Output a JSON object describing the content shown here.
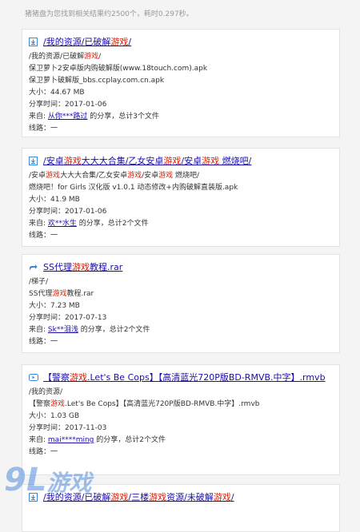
{
  "summary": "猪猪盘为您找到相关结果约2500个，耗时0.297秒。",
  "results": [
    {
      "icon": "download-icon",
      "title": [
        {
          "t": "/我的资源/已破解"
        },
        {
          "t": "游戏",
          "hl": true
        },
        {
          "t": "/"
        }
      ],
      "lines": [
        [
          {
            "t": "/我的资源/已破解"
          },
          {
            "t": "游戏",
            "hl": true
          },
          {
            "t": "/"
          }
        ],
        [
          {
            "t": "保卫萝卜2安卓版内购破解版(www.18touch.com).apk"
          }
        ],
        [
          {
            "t": "保卫萝卜破解版_bbs.ccplay.com.cn.apk"
          }
        ],
        [
          {
            "t": "大小：44.67 MB"
          }
        ],
        [
          {
            "t": "分享时间：2017-01-06"
          }
        ],
        [
          {
            "t": "来自: "
          },
          {
            "t": "从你***路过",
            "link": true
          },
          {
            "t": " 的分享，总计3个文件"
          }
        ],
        [
          {
            "t": "线路：一"
          }
        ]
      ]
    },
    {
      "icon": "download-icon",
      "title": [
        {
          "t": "/安卓"
        },
        {
          "t": "游戏",
          "hl": true
        },
        {
          "t": "大大大合集/乙女安卓"
        },
        {
          "t": "游戏",
          "hl": true
        },
        {
          "t": "/安卓"
        },
        {
          "t": "游戏",
          "hl": true
        },
        {
          "t": " 燃烧吧/"
        }
      ],
      "lines": [
        [
          {
            "t": "/安卓"
          },
          {
            "t": "游戏",
            "hl": true
          },
          {
            "t": "大大大合集/乙女安卓"
          },
          {
            "t": "游戏",
            "hl": true
          },
          {
            "t": "/安卓"
          },
          {
            "t": "游戏",
            "hl": true
          },
          {
            "t": " 燃烧吧/"
          }
        ],
        [
          {
            "t": "燃烧吧！for Girls 汉化版 v1.0.1 动态修改+内购破解直装版.apk"
          }
        ],
        [
          {
            "t": "大小：41.9 MB"
          }
        ],
        [
          {
            "t": "分享时间：2017-01-06"
          }
        ],
        [
          {
            "t": "来自: "
          },
          {
            "t": "欢**水生",
            "link": true
          },
          {
            "t": " 的分享，总计2个文件"
          }
        ],
        [
          {
            "t": "线路：一"
          }
        ]
      ]
    },
    {
      "icon": "share-icon",
      "title": [
        {
          "t": "SS代理"
        },
        {
          "t": "游戏",
          "hl": true
        },
        {
          "t": "教程.rar"
        }
      ],
      "lines": [
        [
          {
            "t": "/梯子/"
          }
        ],
        [
          {
            "t": "SS代理"
          },
          {
            "t": "游戏",
            "hl": true
          },
          {
            "t": "教程.rar"
          }
        ],
        [
          {
            "t": "大小：7.23 MB"
          }
        ],
        [
          {
            "t": "分享时间：2017-07-13"
          }
        ],
        [
          {
            "t": "来自: "
          },
          {
            "t": "Sk**泪浅",
            "link": true
          },
          {
            "t": " 的分享，总计2个文件"
          }
        ],
        [
          {
            "t": "线路：一"
          }
        ]
      ]
    },
    {
      "icon": "video-icon",
      "title": [
        {
          "t": "【警察"
        },
        {
          "t": "游戏",
          "hl": true
        },
        {
          "t": ".Let's Be Cops】【高清蓝光720P版BD-RMVB.中字】.rmvb"
        }
      ],
      "lines": [
        [
          {
            "t": "/我的资源/"
          }
        ],
        [
          {
            "t": "【警察"
          },
          {
            "t": "游戏",
            "hl": true
          },
          {
            "t": ".Let's Be Cops】【高清蓝光720P版BD-RMVB.中字】.rmvb"
          }
        ],
        [
          {
            "t": "大小：1.03 GB"
          }
        ],
        [
          {
            "t": "分享时间：2017-11-03"
          }
        ],
        [
          {
            "t": "来自: "
          },
          {
            "t": "mai****ming",
            "link": true
          },
          {
            "t": " 的分享，总计2个文件"
          }
        ],
        [
          {
            "t": "线路：一"
          }
        ]
      ]
    },
    {
      "icon": "download-icon",
      "title": [
        {
          "t": "/我的资源/已破解"
        },
        {
          "t": "游戏",
          "hl": true
        },
        {
          "t": "/三楼"
        },
        {
          "t": "游戏",
          "hl": true
        },
        {
          "t": "资源/未破解"
        },
        {
          "t": "游戏",
          "hl": true
        },
        {
          "t": "/"
        }
      ],
      "lines": []
    }
  ],
  "watermark": {
    "num": "9L",
    "text": "游戏"
  }
}
